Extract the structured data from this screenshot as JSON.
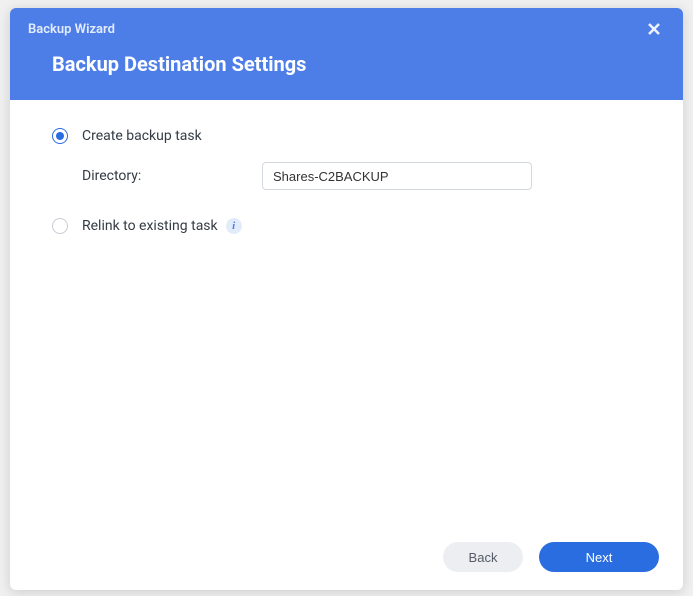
{
  "titlebar": {
    "title": "Backup Wizard"
  },
  "header": {
    "page_title": "Backup Destination Settings"
  },
  "options": {
    "create": {
      "label": "Create backup task",
      "selected": true,
      "directory_label": "Directory:",
      "directory_value": "Shares-C2BACKUP"
    },
    "relink": {
      "label": "Relink to existing task",
      "selected": false
    }
  },
  "footer": {
    "back": "Back",
    "next": "Next"
  }
}
